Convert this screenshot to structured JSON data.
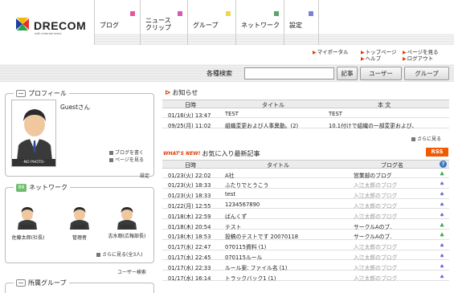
{
  "brand": {
    "logo_text": "DRECOM",
    "logo_sub": "with entertainment"
  },
  "nav": [
    {
      "label": "ブログ",
      "color": "#e8569a"
    },
    {
      "label": "ニュース\nクリップ",
      "color": "#d65bb5"
    },
    {
      "label": "グループ",
      "color": "#f0d64e"
    },
    {
      "label": "ネットワーク",
      "color": "#5aa46b"
    },
    {
      "label": "設定",
      "color": "#7f7fd6"
    }
  ],
  "sublinks": {
    "my_portal": "マイポータル",
    "top_page": "トップページ",
    "view_page": "ページを見る",
    "help": "ヘルプ",
    "logout": "ログアウト"
  },
  "search": {
    "label": "各種検索",
    "value": "",
    "btn_article": "記事",
    "btn_user": "ユーザー",
    "btn_group": "グループ"
  },
  "profile": {
    "title": "プロフィール",
    "name": "Guestさん",
    "no_photo": "-NO PHOTO-",
    "write_blog": "ブログを書く",
    "view_page": "ページを見る",
    "settings": "設定"
  },
  "network": {
    "title": "ネットワーク",
    "members": [
      "佐藤太郎(社長)",
      "管理者",
      "志水剛(広報部長)"
    ],
    "more": "さらに見る(全3人)",
    "user_search": "ユーザー検索"
  },
  "groups": {
    "title": "所属グループ"
  },
  "notices": {
    "title": "お知らせ",
    "columns": {
      "date": "日時",
      "title": "タイトル",
      "body": "本 文"
    },
    "rows": [
      {
        "date": "01/16(火) 13:47",
        "title": "TEST",
        "body": "TEST"
      },
      {
        "date": "09/25(月) 11:02",
        "title": "組織変更および人事異動。(2)",
        "body": "10.1付けで組織の一部変更および、"
      }
    ],
    "more": "さらに見る"
  },
  "favorites": {
    "whats_new": "WHAT'S NEW!",
    "title": "お気に入り最新記事",
    "rss": "RSS",
    "help": "?",
    "columns": {
      "date": "日時",
      "title": "タイトル",
      "blog": "ブログ名"
    },
    "rows": [
      {
        "date": "01/23(火) 22:02",
        "title": "A社",
        "blog": "営業部のブログ",
        "muted": false,
        "suit": "♣",
        "suit_color": "#2fa84a"
      },
      {
        "date": "01/23(火) 18:33",
        "title": "ふたりでとうこう",
        "blog": "入江太郎のブログ",
        "muted": true,
        "suit": "♠",
        "suit_color": "#6b6bd6"
      },
      {
        "date": "01/23(火) 18:33",
        "title": "test",
        "blog": "入江太郎のブログ",
        "muted": true,
        "suit": "♠",
        "suit_color": "#6b6bd6"
      },
      {
        "date": "01/22(月) 12:55",
        "title": "1234567890",
        "blog": "入江太郎のブログ",
        "muted": true,
        "suit": "♠",
        "suit_color": "#6b6bd6"
      },
      {
        "date": "01/18(木) 22:59",
        "title": "ばんくず",
        "blog": "入江太郎のブログ",
        "muted": true,
        "suit": "♠",
        "suit_color": "#6b6bd6"
      },
      {
        "date": "01/18(木) 20:54",
        "title": "テスト",
        "blog": "サークルAのブ.",
        "muted": false,
        "suit": "♣",
        "suit_color": "#2fa84a"
      },
      {
        "date": "01/18(木) 18:53",
        "title": "投稿のテストです 20070118",
        "blog": "サークルAのブ.",
        "muted": false,
        "suit": "♣",
        "suit_color": "#2fa84a"
      },
      {
        "date": "01/17(水) 22:47",
        "title": "070115資料 (1)",
        "blog": "入江太郎のブログ",
        "muted": true,
        "suit": "♠",
        "suit_color": "#6b6bd6"
      },
      {
        "date": "01/17(水) 22:45",
        "title": "070115ルール",
        "blog": "入江太郎のブログ",
        "muted": true,
        "suit": "♠",
        "suit_color": "#6b6bd6"
      },
      {
        "date": "01/17(水) 22:33",
        "title": "ルール案: ファイル名 (1)",
        "blog": "入江太郎のブログ",
        "muted": true,
        "suit": "♠",
        "suit_color": "#6b6bd6"
      },
      {
        "date": "01/17(水) 16:14",
        "title": "トラックバック1 (1)",
        "blog": "入江太郎のブログ",
        "muted": true,
        "suit": "♠",
        "suit_color": "#6b6bd6"
      }
    ]
  },
  "colors": {
    "accent": "#e03c00",
    "rss": "#f15a00",
    "help": "#3a76c4"
  }
}
